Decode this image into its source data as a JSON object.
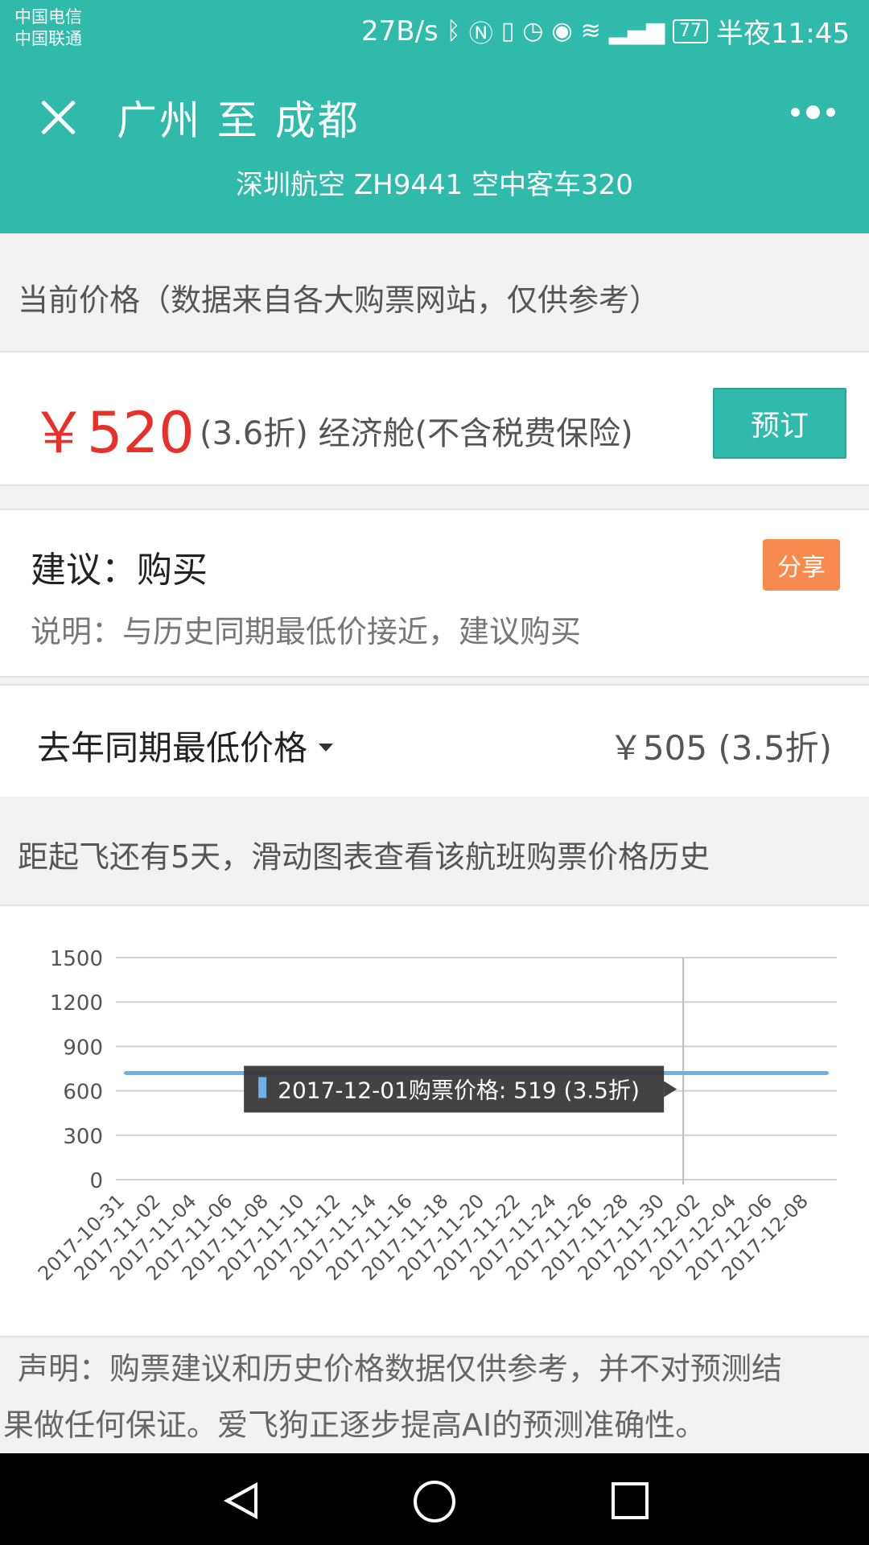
{
  "status_bar": {
    "carrier1": "中国电信",
    "carrier2": "中国联通",
    "speed": "27B/s",
    "battery": "77",
    "time": "半夜11:45"
  },
  "header": {
    "title": "广州 至 成都",
    "subtitle": "深圳航空 ZH9441   空中客车320"
  },
  "current_price": {
    "section_title": "当前价格（数据来自各大购票网站，仅供参考）",
    "price": "￥520",
    "desc": "(3.6折) 经济舱(不含税费保险)",
    "book_label": "预订"
  },
  "advice": {
    "title": "建议：购买",
    "explain": "说明：与历史同期最低价接近，建议购买",
    "share_label": "分享"
  },
  "history": {
    "dropdown_label": "去年同期最低价格",
    "value": "￥505 (3.5折)",
    "hint": "距起飞还有5天，滑动图表查看该航班购票价格历史"
  },
  "chart_data": {
    "type": "line",
    "x": [
      "2017-10-31",
      "2017-11-01",
      "2017-11-02",
      "2017-11-03",
      "2017-11-04",
      "2017-11-05",
      "2017-11-06",
      "2017-11-07",
      "2017-11-08",
      "2017-11-09",
      "2017-11-10",
      "2017-11-11",
      "2017-11-12",
      "2017-11-13",
      "2017-11-14",
      "2017-11-15",
      "2017-11-16",
      "2017-11-17",
      "2017-11-18",
      "2017-11-19",
      "2017-11-20",
      "2017-11-21",
      "2017-11-22",
      "2017-11-23",
      "2017-11-24",
      "2017-11-25",
      "2017-11-26",
      "2017-11-27",
      "2017-11-28",
      "2017-11-29",
      "2017-11-30",
      "2017-12-01",
      "2017-12-02",
      "2017-12-03",
      "2017-12-04",
      "2017-12-05",
      "2017-12-06",
      "2017-12-07",
      "2017-12-08",
      "2017-12-09"
    ],
    "y": [
      720,
      720,
      720,
      720,
      720,
      720,
      720,
      720,
      720,
      720,
      720,
      720,
      720,
      720,
      720,
      720,
      720,
      720,
      720,
      720,
      720,
      720,
      720,
      720,
      720,
      720,
      720,
      720,
      720,
      720,
      720,
      720,
      720,
      720,
      720,
      720,
      720,
      720,
      720,
      720
    ],
    "xticks": [
      "2017-10-31",
      "2017-11-02",
      "2017-11-04",
      "2017-11-06",
      "2017-11-08",
      "2017-11-10",
      "2017-11-12",
      "2017-11-14",
      "2017-11-16",
      "2017-11-18",
      "2017-11-20",
      "2017-11-22",
      "2017-11-24",
      "2017-11-26",
      "2017-11-28",
      "2017-11-30",
      "2017-12-02",
      "2017-12-04",
      "2017-12-06",
      "2017-12-08"
    ],
    "yticks": [
      "1500",
      "1200",
      "900",
      "600",
      "300",
      "0"
    ],
    "ylim": [
      0,
      1500
    ],
    "grid": true,
    "tooltip": {
      "date": "2017-12-01",
      "text": "2017-12-01购票价格: 519 (3.5折)"
    },
    "color": "#6fb0e8"
  },
  "disclaimer": {
    "line1": "声明：购票建议和历史价格数据仅供参考，并不对预测结",
    "line2": "果做任何保证。爱飞狗正逐步提高AI的预测准确性。"
  }
}
